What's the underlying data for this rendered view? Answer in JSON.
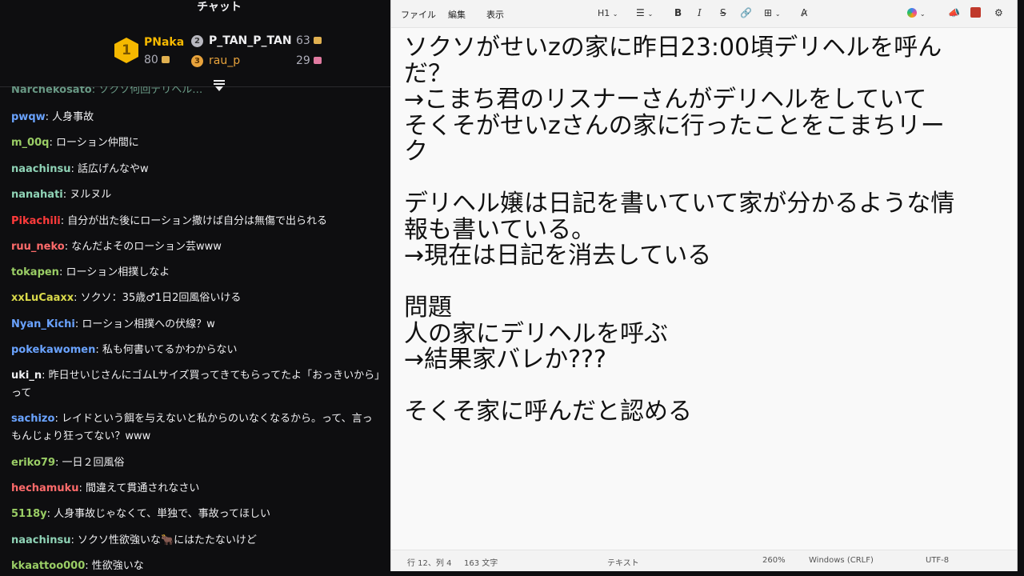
{
  "chat": {
    "title": "チャット",
    "leaderboard": {
      "first": {
        "rank": "1",
        "name": "PNaka",
        "score": "80",
        "color": "#f5b800"
      },
      "second": {
        "rank": "2",
        "name": "P_TAN_P_TAN",
        "score": "63"
      },
      "third": {
        "rank": "3",
        "name": "rau_p",
        "score": "29",
        "color": "#e8a33c"
      }
    },
    "messages": [
      {
        "user": "pwqw",
        "color": "#6aa3ff",
        "text": ": 人身事故"
      },
      {
        "user": "m_00q",
        "color": "#9acd65",
        "text": ": ローション仲間に"
      },
      {
        "user": "naachinsu",
        "color": "#8fd3b6",
        "text": ": 話広げんなやw"
      },
      {
        "user": "nanahati",
        "color": "#8fd3b6",
        "text": ": ヌルヌル"
      },
      {
        "user": "Pikachili",
        "color": "#ff3b3b",
        "text": ": 自分が出た後にローション撒けば自分は無傷で出られる"
      },
      {
        "user": "ruu_neko",
        "color": "#ff6b6b",
        "text": ": なんだよそのローション芸www"
      },
      {
        "user": "tokapen",
        "color": "#9acd65",
        "text": ": ローション相撲しなよ"
      },
      {
        "user": "xxLuCaaxx",
        "color": "#d9d94a",
        "text": ": ソクソ：35歳♂1日2回風俗いける"
      },
      {
        "user": "Nyan_Kichi",
        "color": "#6aa3ff",
        "text": ": ローション相撲への伏線？w"
      },
      {
        "user": "pokekawomen",
        "color": "#6aa3ff",
        "text": ": 私も何書いてるかわからない"
      },
      {
        "user": "uki_n",
        "color": "#efeff1",
        "text": ": 昨日せいじさんにゴムLサイズ買ってきてもらってたよ「おっきいから」",
        "cont": "って"
      },
      {
        "user": "sachizo",
        "color": "#6aa3ff",
        "text": ": レイドという餌を与えないと私からのいなくなるから。って、言っ",
        "cont": "もんじょり狂ってない？www"
      },
      {
        "user": "eriko79",
        "color": "#9acd65",
        "text": ": 一日２回風俗"
      },
      {
        "user": "hechamuku",
        "color": "#ff6b6b",
        "text": ": 間違えて貫通されなさい"
      },
      {
        "user": "5118y",
        "color": "#9acd65",
        "text": ": 人身事故じゃなくて、単独で、事故ってほしい"
      },
      {
        "user": "naachinsu",
        "color": "#8fd3b6",
        "text": ": ソクソ性欲強いな🐂にはたたないけど"
      },
      {
        "user": "kkaattoo000",
        "color": "#9acd65",
        "text": ": 性欲強いな"
      }
    ]
  },
  "notepad": {
    "menu": {
      "file": "ファイル",
      "edit": "編集",
      "view": "表示"
    },
    "toolbar": {
      "heading": "H1",
      "bold": "B",
      "italic": "I",
      "strike": "S"
    },
    "lines": [
      "ソクソがせいzの家に昨日23:00頃デリヘルを呼ん",
      "だ？",
      "→こまち君のリスナーさんがデリヘルをしていて",
      "そくそがせいzさんの家に行ったことをこまちリー",
      "ク",
      "",
      "デリヘル嬢は日記を書いていて家が分かるような情",
      "報も書いている。",
      "→現在は日記を消去している",
      "",
      "問題",
      "人の家にデリヘルを呼ぶ",
      "→結果家バレか???",
      "",
      "そくそ家に呼んだと認める"
    ],
    "status": {
      "position": "行 12、列 4",
      "chars": "163 文字",
      "format": "テキスト",
      "zoom": "260%",
      "line_ending": "Windows (CRLF)",
      "encoding": "UTF-8"
    }
  }
}
